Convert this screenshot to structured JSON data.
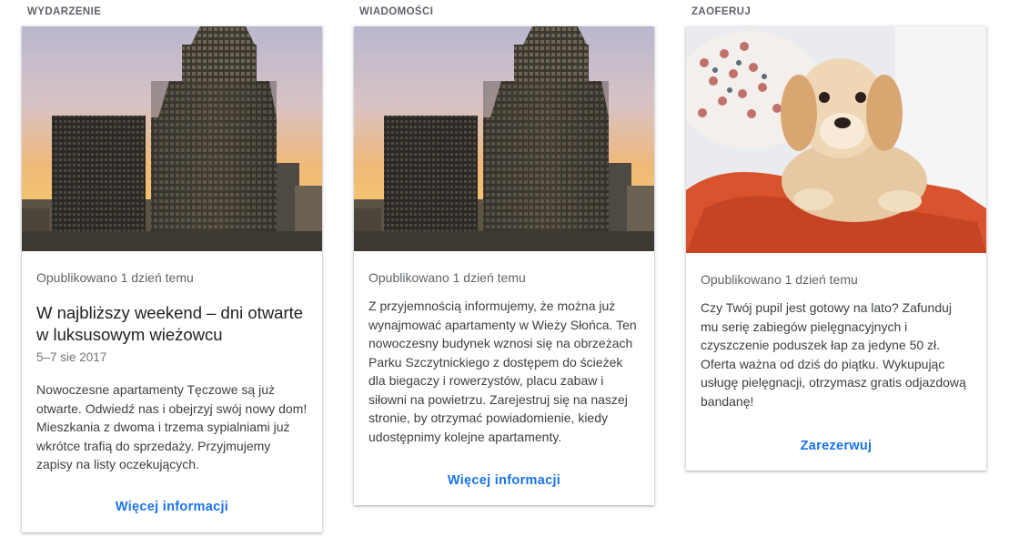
{
  "cards": [
    {
      "category": "WYDARZENIE",
      "image": "skyscraper-sunset-photo",
      "posted": "Opublikowano 1 dzień temu",
      "title": "W najbliższy weekend – dni otwarte w luksusowym wieżowcu",
      "date": "5–7 sie 2017",
      "body": "Nowoczesne apartamenty Tęczowe są już otwarte. Odwiedź nas i obejrzyj swój nowy dom! Mieszkania z dwoma i trzema sypialniami już wkrótce trafią do sprzedaży. Przyjmujemy zapisy na listy oczekujących.",
      "cta": "Więcej informacji"
    },
    {
      "category": "WIADOMOŚCI",
      "image": "skyscraper-sunset-photo",
      "posted": "Opublikowano 1 dzień temu",
      "body": "Z przyjemnością informujemy, że można już wynajmować apartamenty w Wieży Słońca. Ten nowoczesny budynek wznosi się na obrzeżach Parku Szczytnickiego z dostępem do ścieżek dla biegaczy i rowerzystów, placu zabaw i siłowni na powietrzu. Zarejestruj się na naszej stronie, by otrzymać powiadomienie, kiedy udostępnimy kolejne apartamenty.",
      "cta": "Więcej informacji"
    },
    {
      "category": "ZAOFERUJ",
      "image": "puppy-on-blanket-photo",
      "posted": "Opublikowano 1 dzień temu",
      "body": "Czy Twój pupil jest gotowy na lato? Zafunduj mu serię zabiegów pielęgnacyjnych i czyszczenie poduszek łap za jedyne 50 zł. Oferta ważna od dziś do piątku. Wykupując usługę pielęgnacji, otrzymasz gratis odjazdową bandanę!",
      "cta": "Zarezerwuj"
    }
  ]
}
